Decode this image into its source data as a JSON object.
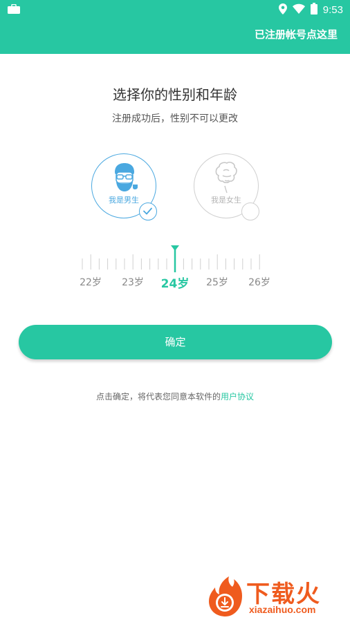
{
  "status_bar": {
    "time": "9:53",
    "icons": [
      "briefcase-icon",
      "location-icon",
      "wifi-icon",
      "battery-icon"
    ]
  },
  "header": {
    "register_link": "已注册帐号点这里",
    "color": "#27c7a2"
  },
  "page": {
    "title": "选择你的性别和年龄",
    "subtitle": "注册成功后，性别不可以更改"
  },
  "gender": {
    "male": {
      "label": "我是男生",
      "selected": true
    },
    "female": {
      "label": "我是女生",
      "selected": false
    }
  },
  "age_picker": {
    "options": [
      "22岁",
      "23岁",
      "24岁",
      "25岁",
      "26岁"
    ],
    "selected": "24岁"
  },
  "confirm_button": {
    "label": "确定"
  },
  "agreement": {
    "prefix": "点击确定，将代表您同意本软件的",
    "link": "用户协议"
  },
  "watermark": {
    "text": "下载火",
    "url": "xiazaihuo.com"
  },
  "colors": {
    "accent": "#27c7a2",
    "male": "#4aa8e0",
    "inactive": "#cfcfcf",
    "watermark": "#ef5b1e"
  }
}
